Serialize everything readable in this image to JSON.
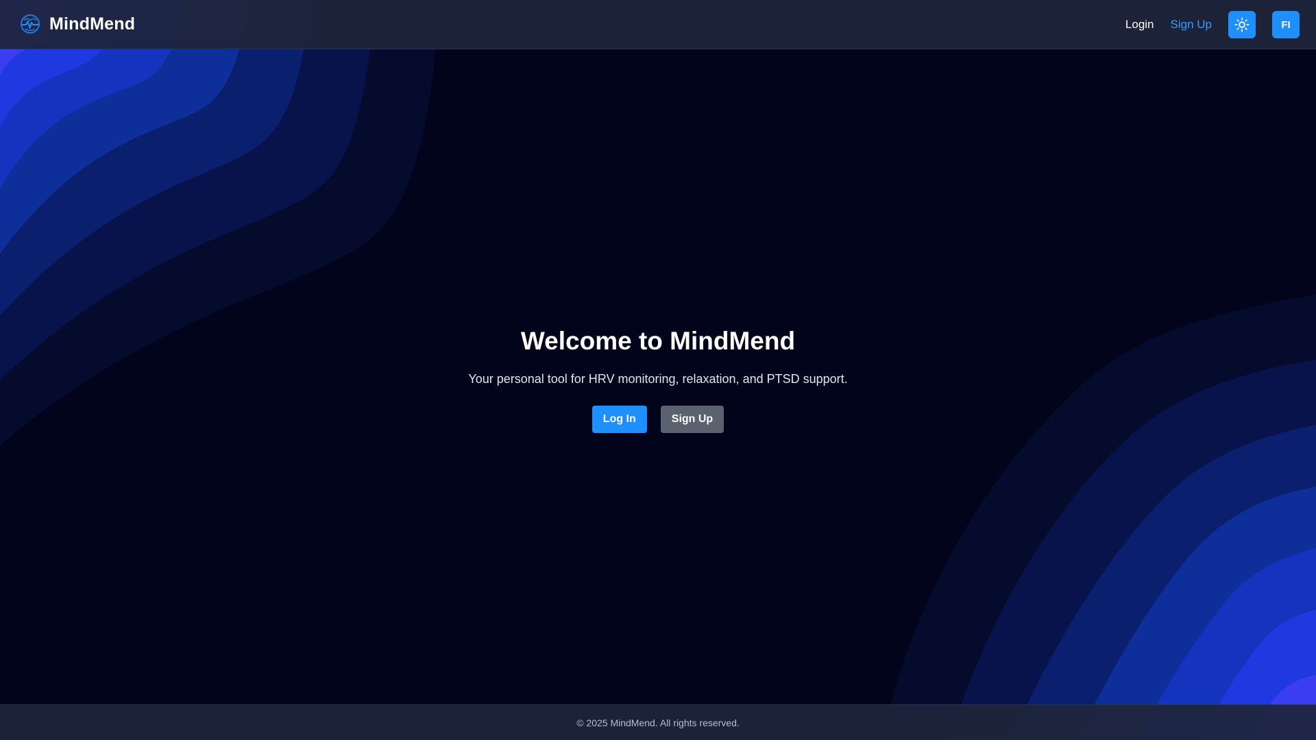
{
  "app": {
    "name": "MindMend",
    "logo_icon": "heart-pulse-brain-icon"
  },
  "nav": {
    "login_label": "Login",
    "signup_label": "Sign Up",
    "theme_toggle_icon": "sun-icon",
    "language_label": "FI"
  },
  "hero": {
    "title": "Welcome to MindMend",
    "subtitle": "Your personal tool for HRV monitoring, relaxation, and PTSD support.",
    "login_button": "Log In",
    "signup_button": "Sign Up"
  },
  "footer": {
    "copyright": "© 2025 MindMend. All rights reserved."
  },
  "colors": {
    "background": "#01041a",
    "accent": "#1f8fff",
    "link": "#3d9bff",
    "secondary_button": "#5a6270",
    "wave_shades": [
      "#050b2c",
      "#07134a",
      "#0a1f6e",
      "#0e2e9a",
      "#1738cf",
      "#3d3df0"
    ]
  }
}
